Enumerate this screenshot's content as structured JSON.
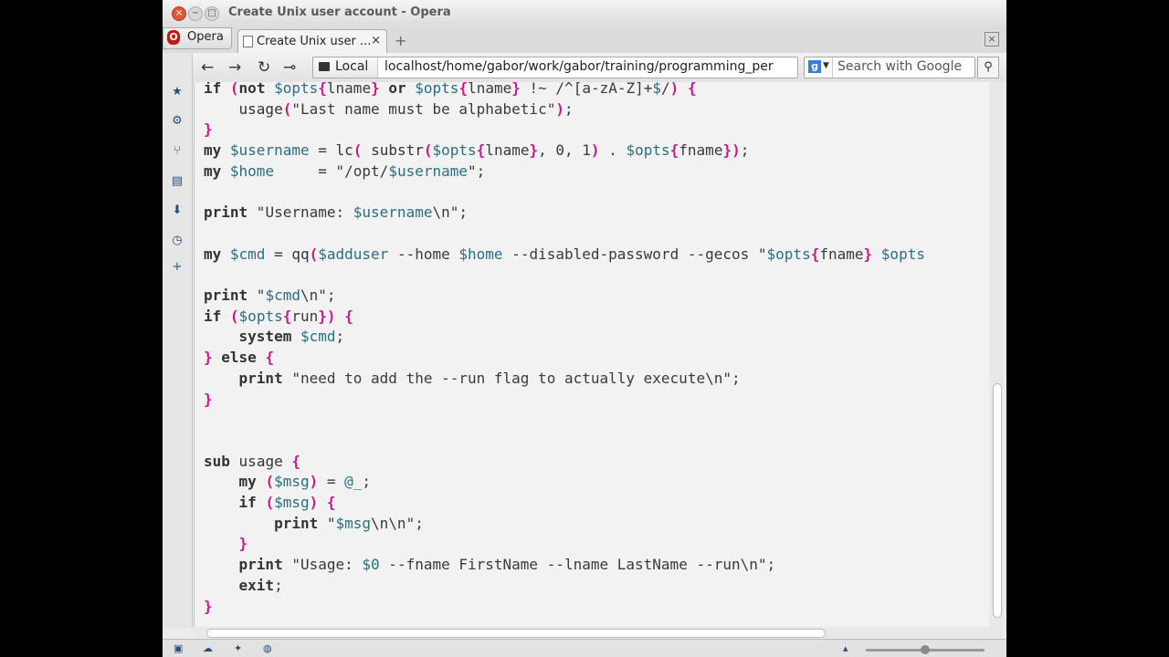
{
  "window": {
    "title": "Create Unix user account - Opera"
  },
  "tabbar": {
    "opera_menu_label": "Opera",
    "tab_label": "Create Unix user ...",
    "tab_close": "×",
    "new_tab": "+"
  },
  "navbar": {
    "back": "←",
    "forward": "→",
    "reload": "↻",
    "key": "⊸",
    "security_label": "Local",
    "url": "localhost/home/gabor/work/gabor/training/programming_per",
    "search_placeholder": "Search with Google",
    "search_button": "⚲"
  },
  "sidebar": {
    "icons": [
      "bookmarks-icon",
      "settings-icon",
      "unite-icon",
      "notes-icon",
      "downloads-icon",
      "history-icon",
      "add-panel-icon"
    ]
  },
  "code_lines": [
    "if (not $opts{lname} or $opts{lname} !~ /^[a-zA-Z]+$/) {",
    "    usage(\"Last name must be alphabetic\");",
    "}",
    "my $username = lc( substr($opts{lname}, 0, 1) . $opts{fname});",
    "my $home     = \"/opt/$username\";",
    "",
    "print \"Username: $username\\n\";",
    "",
    "my $cmd = qq($adduser --home $home --disabled-password --gecos \"$opts{fname} $opts",
    "",
    "print \"$cmd\\n\";",
    "if ($opts{run}) {",
    "    system $cmd;",
    "} else {",
    "    print \"need to add the --run flag to actually execute\\n\";",
    "}",
    "",
    "",
    "sub usage {",
    "    my ($msg) = @_;",
    "    if ($msg) {",
    "        print \"$msg\\n\\n\";",
    "    }",
    "    print \"Usage: $0 --fname FirstName --lname LastName --run\\n\";",
    "    exit;",
    "}"
  ],
  "colors": {
    "keyword": "#7a1e50",
    "brace": "#c8198a",
    "variable": "#2a6f80",
    "background": "#f2f2f2"
  }
}
